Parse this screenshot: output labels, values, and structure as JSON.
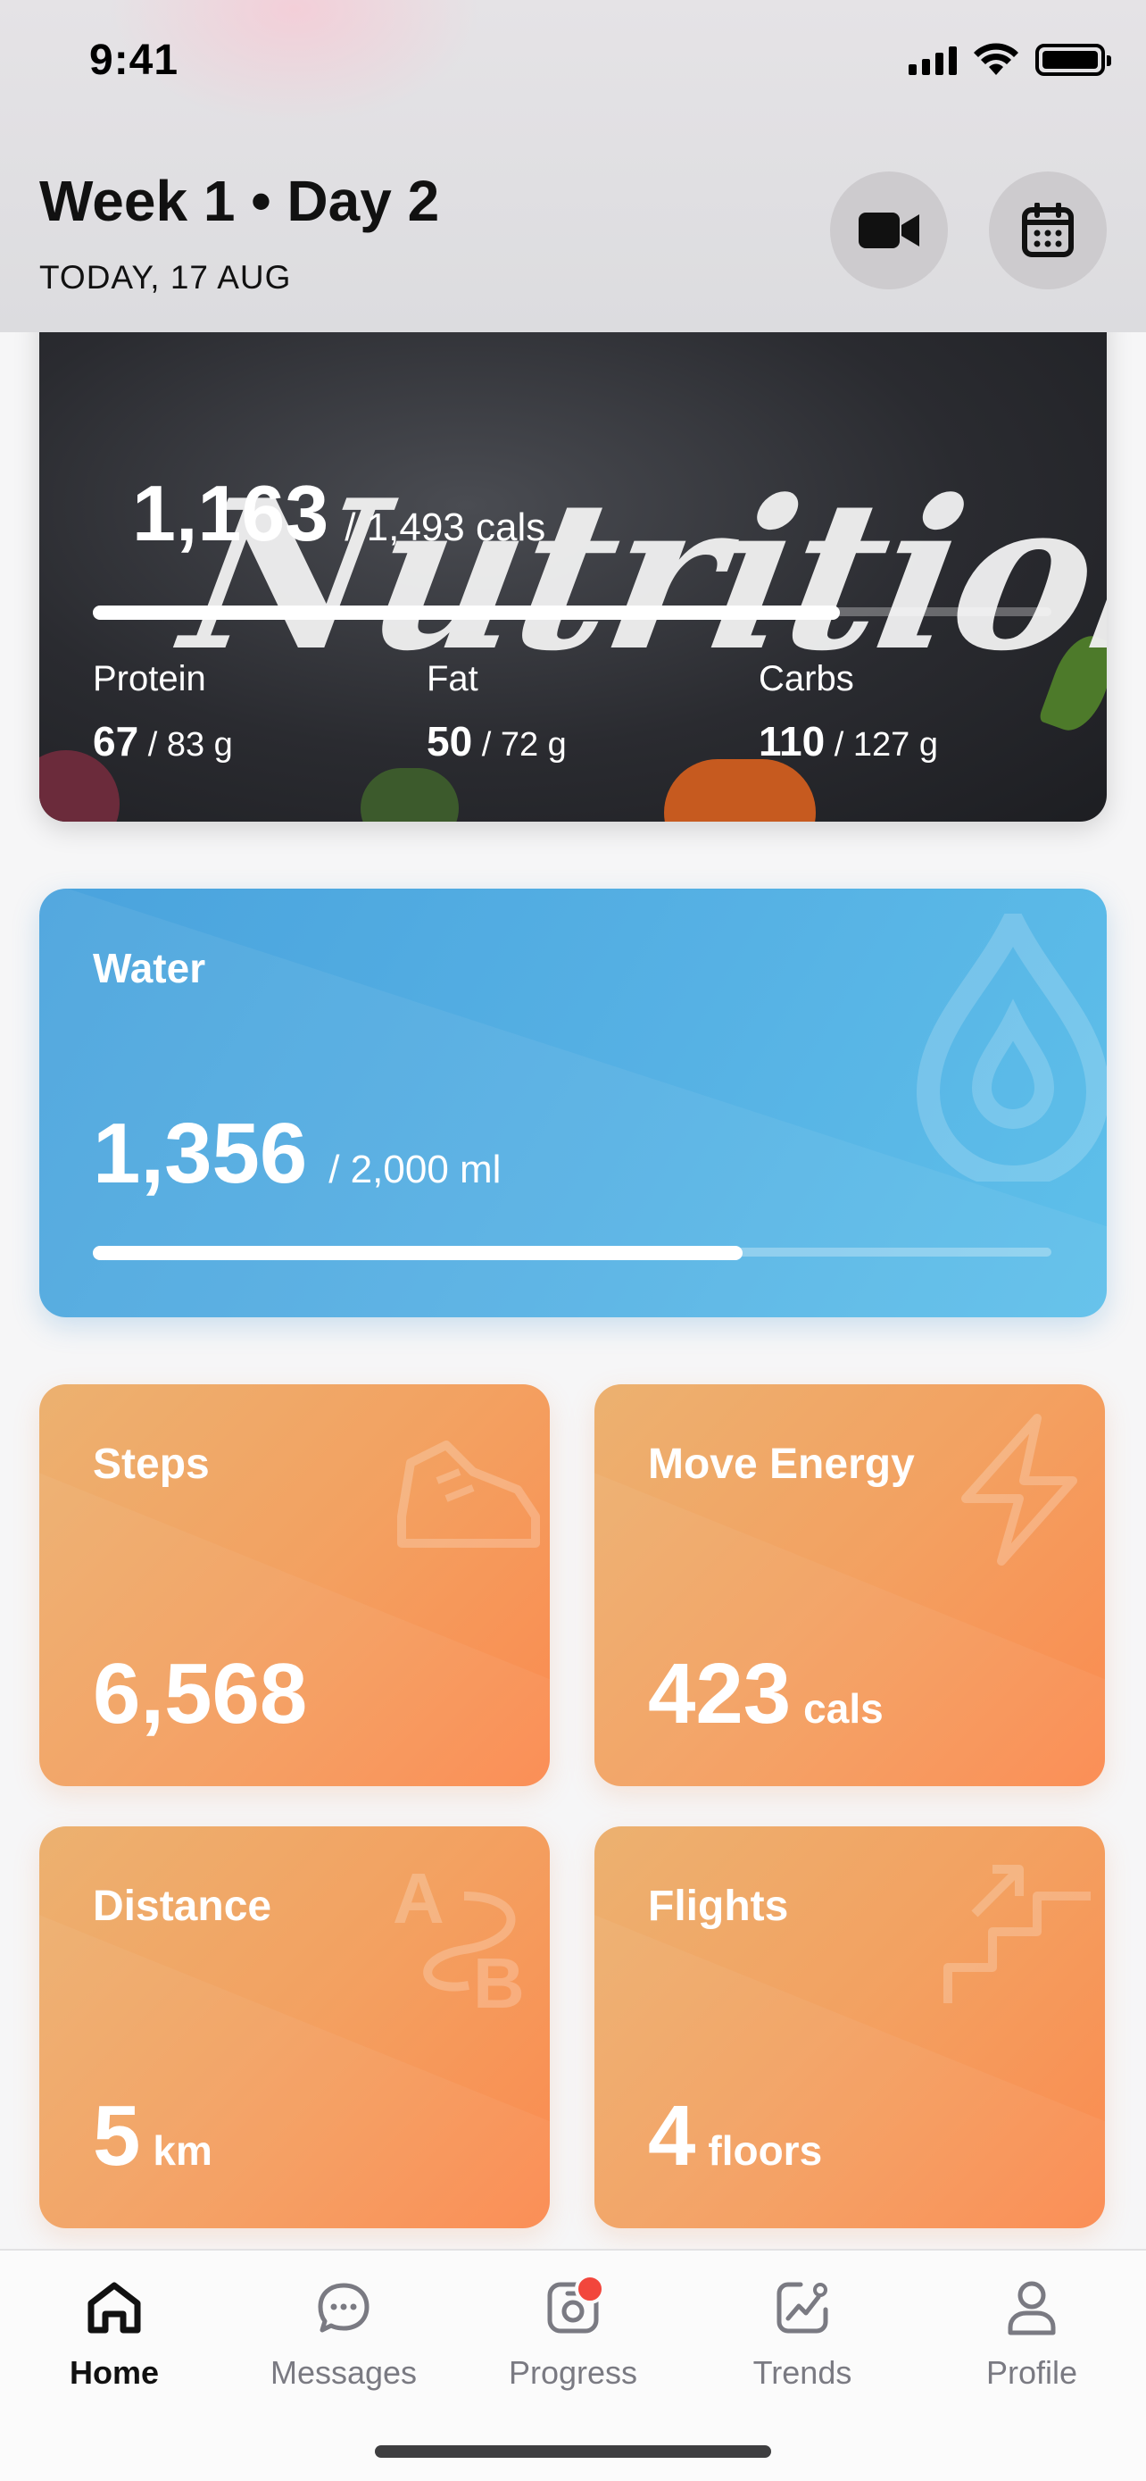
{
  "status_bar": {
    "time": "9:41"
  },
  "header": {
    "title": "Week 1 • Day 2",
    "date": "TODAY, 17 AUG"
  },
  "nutrition": {
    "script_title": "Nutrition",
    "calories": "1,163",
    "calories_goal": "/ 1,493 cals",
    "calories_progress": 0.779,
    "protein_label": "Protein",
    "protein_value": "67",
    "protein_goal": " / 83 g",
    "fat_label": "Fat",
    "fat_value": "50",
    "fat_goal": " / 72 g",
    "carbs_label": "Carbs",
    "carbs_value": "110",
    "carbs_goal": " / 127 g"
  },
  "water": {
    "title": "Water",
    "value": "1,356",
    "goal": "/  2,000 ml",
    "progress": 0.678
  },
  "cards": {
    "steps": {
      "title": "Steps",
      "value": "6,568",
      "unit": ""
    },
    "move": {
      "title": "Move Energy",
      "value": "423",
      "unit": "cals"
    },
    "distance": {
      "title": "Distance",
      "value": "5",
      "unit": "km"
    },
    "flights": {
      "title": "Flights",
      "value": "4",
      "unit": "floors"
    }
  },
  "tabs": [
    {
      "label": "Home",
      "icon": "home-icon",
      "active": true
    },
    {
      "label": "Messages",
      "icon": "chat-icon",
      "active": false
    },
    {
      "label": "Progress",
      "icon": "scale-icon",
      "active": false,
      "badge": true
    },
    {
      "label": "Trends",
      "icon": "trend-chart-icon",
      "active": false
    },
    {
      "label": "Profile",
      "icon": "person-icon",
      "active": false
    }
  ],
  "colors": {
    "water_card": "#56b1e4",
    "activity_card": "#f3a161",
    "badge": "#f2463c"
  }
}
